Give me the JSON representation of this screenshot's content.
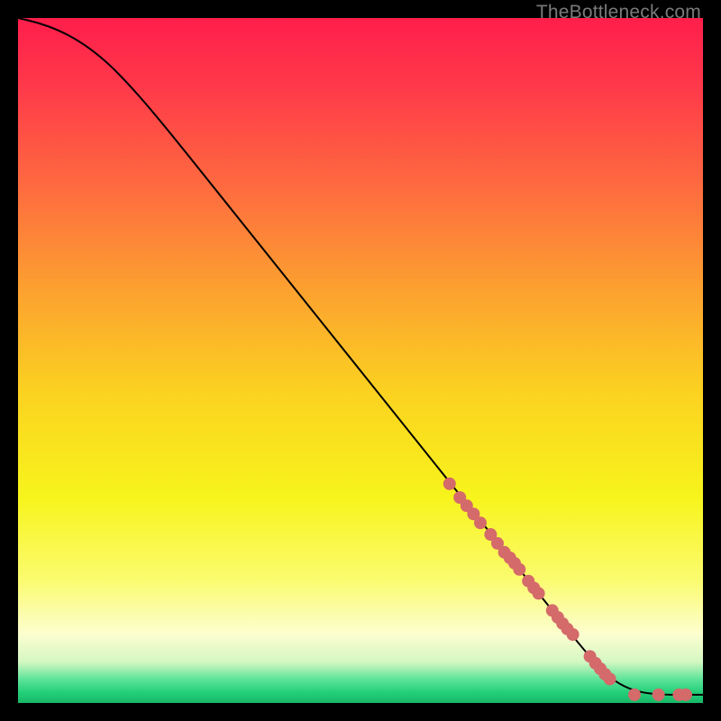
{
  "watermark": "TheBottleneck.com",
  "chart_data": {
    "type": "line",
    "title": "",
    "xlabel": "",
    "ylabel": "",
    "xlim": [
      0,
      100
    ],
    "ylim": [
      0,
      100
    ],
    "grid": false,
    "legend": false,
    "gradient_stops": [
      {
        "offset": 0.0,
        "color": "#ff1e4b"
      },
      {
        "offset": 0.1,
        "color": "#ff394a"
      },
      {
        "offset": 0.25,
        "color": "#fe6c3f"
      },
      {
        "offset": 0.4,
        "color": "#fca22f"
      },
      {
        "offset": 0.55,
        "color": "#fbd320"
      },
      {
        "offset": 0.7,
        "color": "#f7f41c"
      },
      {
        "offset": 0.82,
        "color": "#fbfb6f"
      },
      {
        "offset": 0.9,
        "color": "#fcfed0"
      },
      {
        "offset": 0.94,
        "color": "#d4f7c2"
      },
      {
        "offset": 0.965,
        "color": "#5fe49a"
      },
      {
        "offset": 0.985,
        "color": "#23cf79"
      },
      {
        "offset": 1.0,
        "color": "#18b768"
      }
    ],
    "series": [
      {
        "name": "curve",
        "stroke": "#000000",
        "x": [
          0,
          3,
          6,
          9,
          12,
          15,
          20,
          30,
          40,
          50,
          60,
          70,
          78,
          82,
          85,
          88,
          92,
          100
        ],
        "y": [
          100,
          99.3,
          98.2,
          96.6,
          94.4,
          91.6,
          86,
          73.5,
          61,
          48.5,
          36,
          23.5,
          13.5,
          8.5,
          5,
          2.5,
          1.2,
          1.2
        ]
      }
    ],
    "scatter": {
      "name": "points",
      "color": "#d46a6a",
      "radius": 7,
      "x": [
        63,
        64.5,
        65.5,
        66.5,
        67.5,
        69,
        70,
        71,
        71.8,
        72.5,
        73.2,
        74.5,
        75.3,
        76,
        78,
        78.8,
        79.5,
        80.2,
        81,
        83.5,
        84.3,
        85,
        85.7,
        86.4,
        90,
        93.5,
        96.5,
        97.5
      ],
      "y": [
        32,
        30,
        28.8,
        27.6,
        26.3,
        24.6,
        23.3,
        22,
        21.2,
        20.4,
        19.5,
        17.8,
        16.8,
        16,
        13.5,
        12.5,
        11.6,
        10.8,
        10,
        6.8,
        5.8,
        5,
        4.2,
        3.5,
        1.2,
        1.2,
        1.2,
        1.2
      ]
    }
  }
}
